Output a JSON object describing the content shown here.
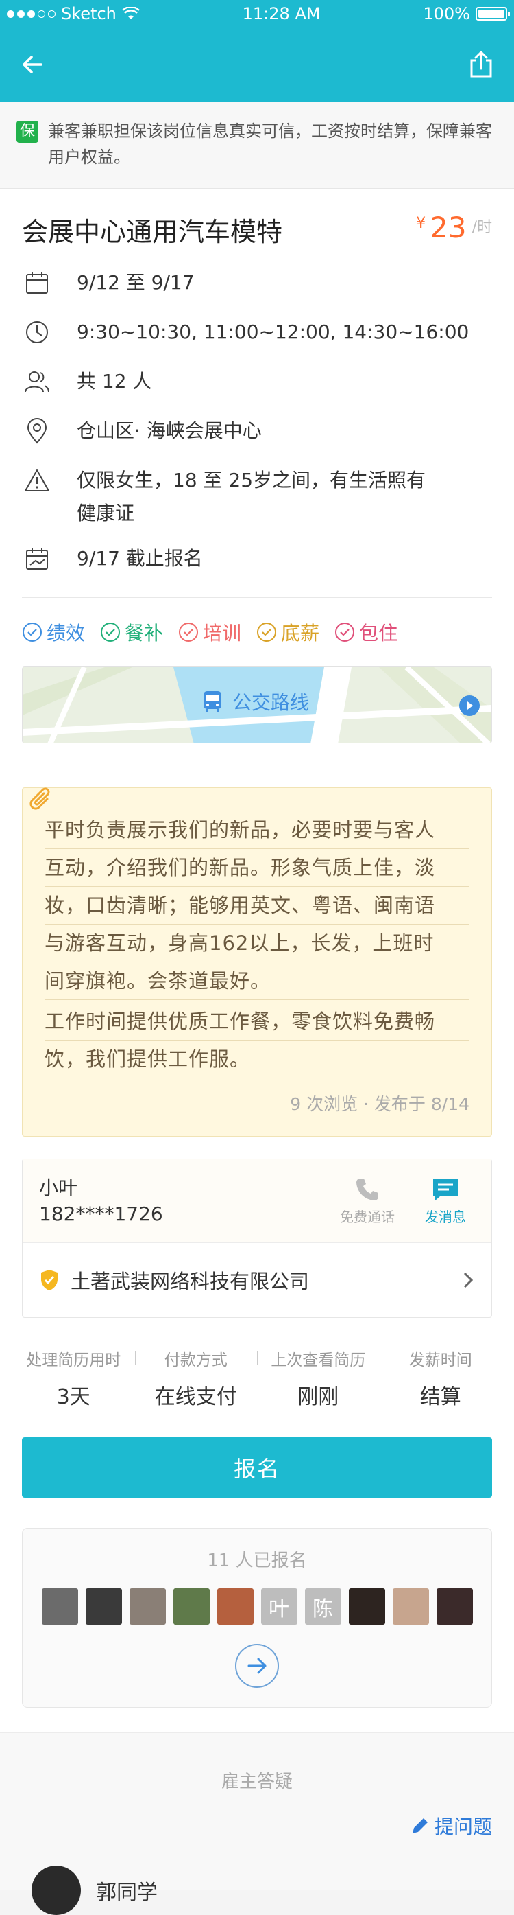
{
  "status_bar": {
    "carrier": "Sketch",
    "time": "11:28 AM",
    "battery": "100%"
  },
  "guarantee": {
    "badge": "保",
    "text": "兼客兼职担保该岗位信息真实可信，工资按时结算，保障兼客用户权益。"
  },
  "job": {
    "title": "会展中心通用汽车模特",
    "price_currency": "¥",
    "price": "23",
    "price_unit": "/时",
    "date": "9/12 至 9/17",
    "time": "9:30~10:30, 11:00~12:00, 14:30~16:00",
    "headcount": "共 12 人",
    "location": "仓山区· 海峡会展中心",
    "requirement": "仅限女生，18 至 25岁之间，有生活照有健康证",
    "deadline": "9/17 截止报名"
  },
  "tags": [
    {
      "label": "绩效",
      "color": "#3f8fe0"
    },
    {
      "label": "餐补",
      "color": "#22b07a"
    },
    {
      "label": "培训",
      "color": "#f06a6a"
    },
    {
      "label": "底薪",
      "color": "#d9a227"
    },
    {
      "label": "包住",
      "color": "#e0507a"
    }
  ],
  "map": {
    "label": "公交路线"
  },
  "description": {
    "lines": [
      "平时负责展示我们的新品，必要时要与客人",
      "互动，介绍我们的新品。形象气质上佳，淡",
      "妆，口齿清晰；能够用英文、粤语、闽南语",
      "与游客互动，身高162以上，长发，上班时",
      "间穿旗袍。会茶道最好。",
      "工作时间提供优质工作餐，零食饮料免费畅",
      "饮，我们提供工作服。"
    ],
    "meta": "9 次浏览 · 发布于 8/14"
  },
  "contact": {
    "name": "小叶",
    "phone": "182****1726",
    "call_label": "免费通话",
    "message_label": "发消息",
    "company": "土著武装网络科技有限公司"
  },
  "stats": [
    {
      "label": "处理简历用时",
      "value": "3天"
    },
    {
      "label": "付款方式",
      "value": "在线支付"
    },
    {
      "label": "上次查看简历",
      "value": "刚刚"
    },
    {
      "label": "发薪时间",
      "value": "结算"
    }
  ],
  "signup_label": "报名",
  "applicants": {
    "count_text": "11 人已报名",
    "avatars": [
      {
        "text": "",
        "color": "#6b6b6b"
      },
      {
        "text": "",
        "color": "#3a3a3a"
      },
      {
        "text": "",
        "color": "#8a7f76"
      },
      {
        "text": "",
        "color": "#5f7a4a"
      },
      {
        "text": "",
        "color": "#b5603e"
      },
      {
        "text": "叶",
        "color": "#bdbdbd"
      },
      {
        "text": "陈",
        "color": "#bdbdbd"
      },
      {
        "text": "",
        "color": "#2d2420"
      },
      {
        "text": "",
        "color": "#c7a58e"
      },
      {
        "text": "",
        "color": "#3b2a2a"
      }
    ]
  },
  "qa": {
    "heading": "雇主答疑",
    "ask_label": "提问题",
    "asker_name": "郭同学"
  }
}
